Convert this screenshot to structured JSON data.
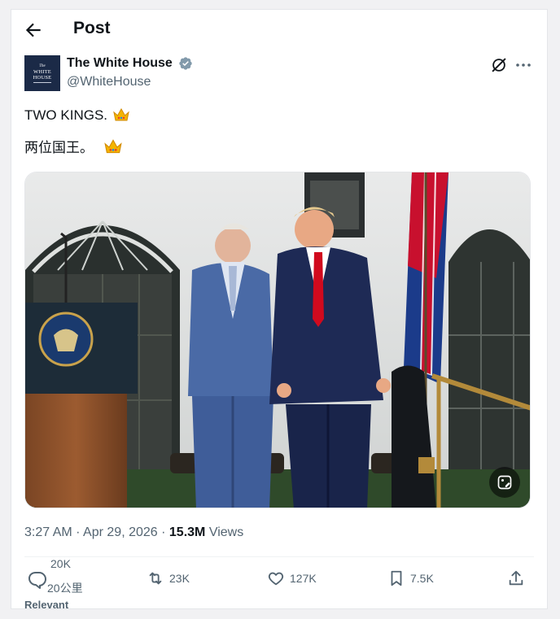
{
  "header": {
    "title": "Post",
    "back_icon": "arrow-left-icon"
  },
  "author": {
    "name": "The White House",
    "handle": "@WhiteHouse",
    "verified_color": "#829aab",
    "avatar": {
      "line1": "The",
      "line2": "WHITE",
      "line3": "HOUSE",
      "bg": "#1b2a47"
    }
  },
  "tweet": {
    "line1_text": "TWO KINGS.",
    "line1_emoji": "crown-icon",
    "line2_text": "两位国王。",
    "line2_emoji": "crown-icon",
    "image_subject": "photo-two-men-podium-flag"
  },
  "meta": {
    "time": "3:27 AM",
    "separator": " · ",
    "date": "Apr 29, 2026",
    "views_count": "15.3M",
    "views_label": "Views"
  },
  "actions": {
    "reply_count": "20K",
    "reply_sub": "20公里",
    "repost_count": "23K",
    "like_count": "127K",
    "bookmark_count": "7.5K"
  },
  "footer": {
    "relevant_label": "Relevant"
  },
  "colors": {
    "accent": "#1d9bf0",
    "secondary_text": "#536471",
    "text": "#0f1419"
  }
}
